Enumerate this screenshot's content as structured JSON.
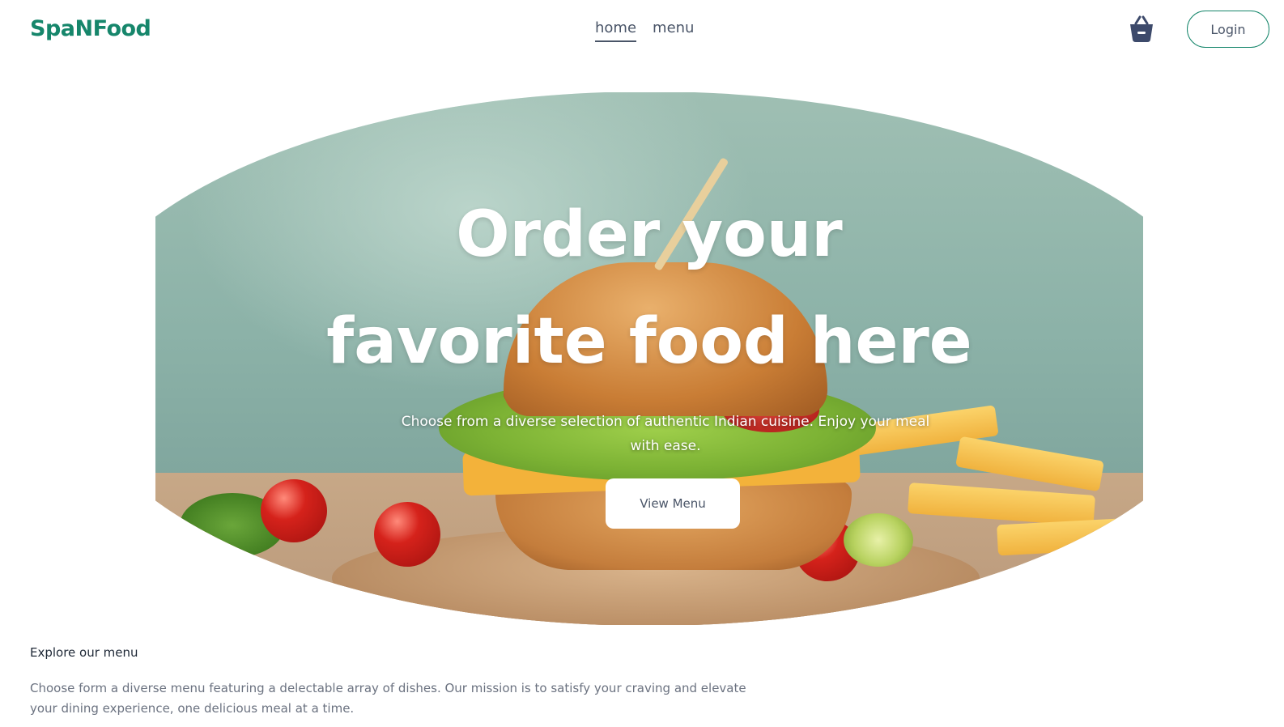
{
  "brand": {
    "name": "SpaNFood",
    "color": "#16866b"
  },
  "nav": {
    "links": [
      {
        "label": "home",
        "active": true
      },
      {
        "label": "menu",
        "active": false
      }
    ],
    "cart_icon": "basket-icon",
    "login_label": "Login"
  },
  "hero": {
    "title_line1": "Order your",
    "title_line2": "favorite food here",
    "subtitle": "Choose from a diverse selection of authentic Indian cuisine. Enjoy your meal with ease.",
    "cta_label": "View Menu",
    "image_subject": "burger-with-fries-and-tomatoes"
  },
  "explore": {
    "title": "Explore our menu",
    "description": "Choose form a diverse menu featuring a delectable array of dishes. Our mission is to satisfy your craving and elevate your dining experience, one delicious meal at a time."
  }
}
